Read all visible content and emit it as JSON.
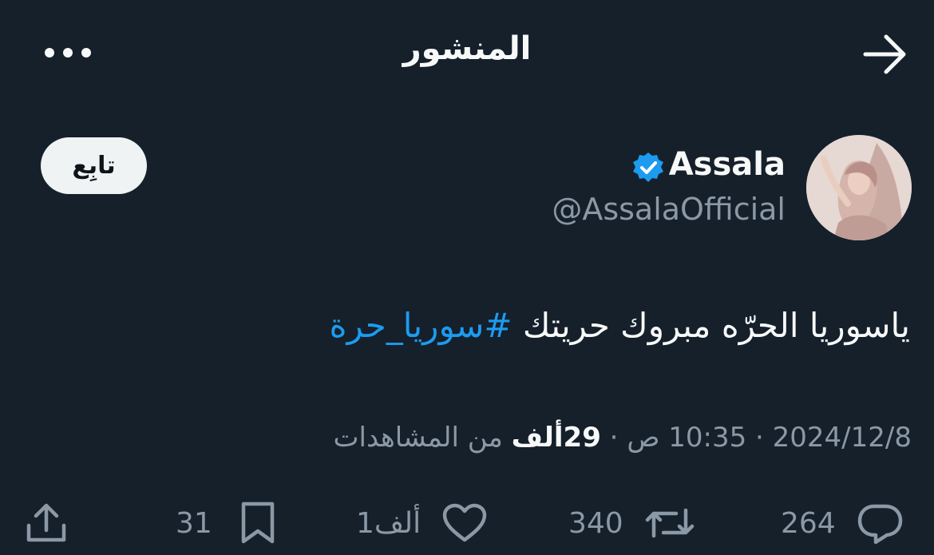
{
  "header": {
    "title": "المنشور"
  },
  "author": {
    "display_name": "Assala",
    "handle": "@AssalaOfficial",
    "follow_label": "تابِع"
  },
  "tweet": {
    "text": "ياسوريا الحرّه مبروك حريتك ",
    "hashtag": "#سوريا_حرة"
  },
  "meta": {
    "date": "2024/12/8",
    "separator_1": " · ",
    "time": "10:35 ص",
    "separator_2": " · ",
    "views_count": "29ألف",
    "views_label": " من المشاهدات"
  },
  "actions": {
    "replies": "264",
    "reposts": "340",
    "likes": "1ألف",
    "bookmarks": "31"
  },
  "colors": {
    "background": "#15202b",
    "accent": "#1d9bf0",
    "muted": "#8b98a5",
    "text": "#f7f9f9"
  }
}
